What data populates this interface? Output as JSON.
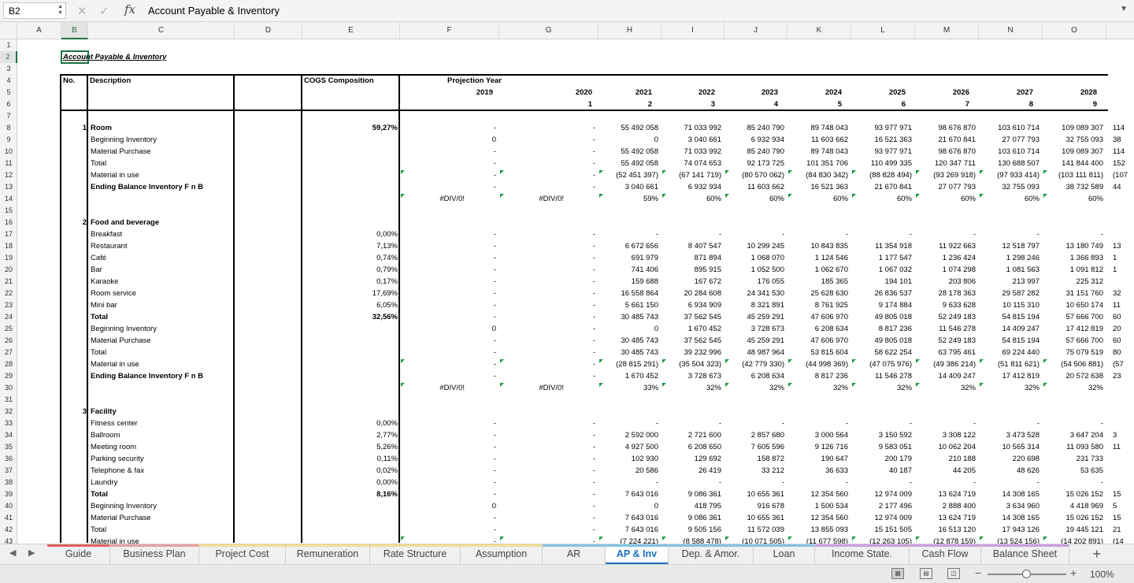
{
  "formula_bar": {
    "name_box": "B2",
    "cancel_icon": "✕",
    "enter_icon": "✓",
    "fx_label": "fx",
    "formula": "Account Payable & Inventory"
  },
  "columns": [
    "A",
    "B",
    "C",
    "D",
    "E",
    "F",
    "G",
    "H",
    "I",
    "J",
    "K",
    "L",
    "M",
    "N",
    "O"
  ],
  "active_column": "B",
  "active_row": 2,
  "rows_visible": [
    1,
    2,
    3,
    4,
    5,
    6,
    7,
    8,
    9,
    10,
    11,
    12,
    13,
    14,
    15,
    16,
    17,
    18,
    19,
    20,
    21,
    22,
    23,
    24,
    25,
    26,
    27,
    28,
    29,
    30,
    31,
    32,
    33,
    34,
    35,
    36,
    37,
    38,
    39,
    40,
    41,
    42,
    43
  ],
  "sheet": {
    "title": "Account Payable & Inventory",
    "header": {
      "no": "No.",
      "description": "Description",
      "cogs": "COGS Composition",
      "projection": "Projection Year",
      "years": [
        "2019",
        "2020",
        "2021",
        "2022",
        "2023",
        "2024",
        "2025",
        "2026",
        "2027",
        "2028"
      ],
      "year_index": [
        "",
        "1",
        "2",
        "3",
        "4",
        "5",
        "6",
        "7",
        "8",
        "9"
      ]
    },
    "rows": [
      {
        "r": 8,
        "no": "1",
        "desc": "Room",
        "bold": true,
        "e": "59,27%",
        "f": "-",
        "g": "-",
        "v": [
          "55 492 058",
          "71 033 992",
          "85 240 790",
          "89 748 043",
          "93 977 971",
          "98 676 870",
          "103 610 714",
          "109 089 307"
        ],
        "p": "114"
      },
      {
        "r": 9,
        "desc": "Beginning Inventory",
        "f": "0",
        "g": "-",
        "v": [
          "0",
          "3 040 661",
          "6 932 934",
          "11 603 662",
          "16 521 363",
          "21 670 841",
          "27 077 793",
          "32 755 093"
        ],
        "p": "38"
      },
      {
        "r": 10,
        "desc": "Material Purchase",
        "f": "-",
        "g": "-",
        "v": [
          "55 492 058",
          "71 033 992",
          "85 240 790",
          "89 748 043",
          "93 977 971",
          "98 676 870",
          "103 610 714",
          "109 089 307"
        ],
        "p": "114"
      },
      {
        "r": 11,
        "desc": "Total",
        "f": "-",
        "g": "-",
        "v": [
          "55 492 058",
          "74 074 653",
          "92 173 725",
          "101 351 706",
          "110 499 335",
          "120 347 711",
          "130 688 507",
          "141 844 400"
        ],
        "p": "152"
      },
      {
        "r": 12,
        "desc": "Material in use",
        "f": "-",
        "g": "-",
        "v": [
          "(52 451 397)",
          "(67 141 719)",
          "(80 570 062)",
          "(84 830 342)",
          "(88 828 494)",
          "(93 269 918)",
          "(97 933 414)",
          "(103 111 811)"
        ],
        "p": "(107"
      },
      {
        "r": 13,
        "desc": "Ending Balance Inventory F n B",
        "bold": true,
        "f": "-",
        "g": "-",
        "v": [
          "3 040 661",
          "6 932 934",
          "11 603 662",
          "16 521 363",
          "21 670 841",
          "27 077 793",
          "32 755 093",
          "38 732 589"
        ],
        "p": "44"
      },
      {
        "r": 14,
        "desc": "",
        "f": "#DIV/0!",
        "g": "#DIV/0!",
        "v": [
          "59%",
          "60%",
          "60%",
          "60%",
          "60%",
          "60%",
          "60%",
          "60%"
        ],
        "p": ""
      },
      {
        "r": 16,
        "no": "2",
        "desc": "Food and beverage",
        "bold": true
      },
      {
        "r": 17,
        "desc": "Breakfast",
        "e": "0,00%",
        "f": "-",
        "g": "-",
        "v": [
          "-",
          "-",
          "-",
          "-",
          "-",
          "-",
          "-",
          "-"
        ],
        "p": ""
      },
      {
        "r": 18,
        "desc": "Restaurant",
        "e": "7,13%",
        "f": "-",
        "g": "-",
        "v": [
          "6 672 656",
          "8 407 547",
          "10 299 245",
          "10 843 835",
          "11 354 918",
          "11 922 663",
          "12 518 797",
          "13 180 749"
        ],
        "p": "13"
      },
      {
        "r": 19,
        "desc": "Café",
        "e": "0,74%",
        "f": "-",
        "g": "-",
        "v": [
          "691 979",
          "871 894",
          "1 068 070",
          "1 124 546",
          "1 177 547",
          "1 236 424",
          "1 298 246",
          "1 366 893"
        ],
        "p": "1"
      },
      {
        "r": 20,
        "desc": "Bar",
        "e": "0,79%",
        "f": "-",
        "g": "-",
        "v": [
          "741 406",
          "895 915",
          "1 052 500",
          "1 062 670",
          "1 067 032",
          "1 074 298",
          "1 081 563",
          "1 091 812"
        ],
        "p": "1"
      },
      {
        "r": 21,
        "desc": "Karaoke",
        "e": "0,17%",
        "f": "-",
        "g": "-",
        "v": [
          "159 688",
          "167 672",
          "176 055",
          "185 365",
          "194 101",
          "203 806",
          "213 997",
          "225 312"
        ],
        "p": ""
      },
      {
        "r": 22,
        "desc": "Room service",
        "e": "17,69%",
        "f": "-",
        "g": "-",
        "v": [
          "16 558 864",
          "20 284 608",
          "24 341 530",
          "25 628 630",
          "26 836 537",
          "28 178 363",
          "29 587 282",
          "31 151 760"
        ],
        "p": "32"
      },
      {
        "r": 23,
        "desc": "Mini bar",
        "e": "6,05%",
        "f": "-",
        "g": "-",
        "v": [
          "5 661 150",
          "6 934 909",
          "8 321 891",
          "8 761 925",
          "9 174 884",
          "9 633 628",
          "10 115 310",
          "10 650 174"
        ],
        "p": "11"
      },
      {
        "r": 24,
        "desc": "Total",
        "bold": true,
        "e": "32,56%",
        "f": "-",
        "g": "-",
        "v": [
          "30 485 743",
          "37 562 545",
          "45 259 291",
          "47 606 970",
          "49 805 018",
          "52 249 183",
          "54 815 194",
          "57 666 700"
        ],
        "p": "60"
      },
      {
        "r": 25,
        "desc": "Beginning Inventory",
        "f": "0",
        "g": "-",
        "v": [
          "0",
          "1 670 452",
          "3 728 673",
          "6 208 634",
          "8 817 236",
          "11 546 278",
          "14 409 247",
          "17 412 819"
        ],
        "p": "20"
      },
      {
        "r": 26,
        "desc": "Material Purchase",
        "f": "-",
        "g": "-",
        "v": [
          "30 485 743",
          "37 562 545",
          "45 259 291",
          "47 606 970",
          "49 805 018",
          "52 249 183",
          "54 815 194",
          "57 666 700"
        ],
        "p": "60"
      },
      {
        "r": 27,
        "desc": "Total",
        "f": "-",
        "g": "-",
        "v": [
          "30 485 743",
          "39 232 996",
          "48 987 964",
          "53 815 604",
          "58 622 254",
          "63 795 461",
          "69 224 440",
          "75 079 519"
        ],
        "p": "80"
      },
      {
        "r": 28,
        "desc": "Material in use",
        "f": "-",
        "g": "-",
        "v": [
          "(28 815 291)",
          "(35 504 323)",
          "(42 779 330)",
          "(44 998 369)",
          "(47 075 976)",
          "(49 386 214)",
          "(51 811 621)",
          "(54 506 881)"
        ],
        "p": "(57"
      },
      {
        "r": 29,
        "desc": "Ending Balance Inventory F n B",
        "bold": true,
        "f": "-",
        "g": "-",
        "v": [
          "1 670 452",
          "3 728 673",
          "6 208 634",
          "8 817 236",
          "11 546 278",
          "14 409 247",
          "17 412 819",
          "20 572 638"
        ],
        "p": "23"
      },
      {
        "r": 30,
        "desc": "",
        "f": "#DIV/0!",
        "g": "#DIV/0!",
        "v": [
          "33%",
          "32%",
          "32%",
          "32%",
          "32%",
          "32%",
          "32%",
          "32%"
        ],
        "p": ""
      },
      {
        "r": 32,
        "no": "3",
        "desc": "Facility",
        "bold": true
      },
      {
        "r": 33,
        "desc": "Fitness center",
        "e": "0,00%",
        "f": "-",
        "g": "-",
        "v": [
          "-",
          "-",
          "-",
          "-",
          "-",
          "-",
          "-",
          "-"
        ],
        "p": ""
      },
      {
        "r": 34,
        "desc": "Ballroom",
        "e": "2,77%",
        "f": "-",
        "g": "-",
        "v": [
          "2 592 000",
          "2 721 600",
          "2 857 680",
          "3 000 564",
          "3 150 592",
          "3 308 122",
          "3 473 528",
          "3 647 204"
        ],
        "p": "3"
      },
      {
        "r": 35,
        "desc": "Meeting room",
        "e": "5,26%",
        "f": "-",
        "g": "-",
        "v": [
          "4 927 500",
          "6 208 650",
          "7 605 596",
          "9 126 716",
          "9 583 051",
          "10 062 204",
          "10 565 314",
          "11 093 580"
        ],
        "p": "11"
      },
      {
        "r": 36,
        "desc": "Parking security",
        "e": "0,11%",
        "f": "-",
        "g": "-",
        "v": [
          "102 930",
          "129 692",
          "158 872",
          "190 647",
          "200 179",
          "210 188",
          "220 698",
          "231 733"
        ],
        "p": ""
      },
      {
        "r": 37,
        "desc": "Telephone & fax",
        "e": "0,02%",
        "f": "-",
        "g": "-",
        "v": [
          "20 586",
          "26 419",
          "33 212",
          "36 633",
          "40 187",
          "44 205",
          "48 626",
          "53 635"
        ],
        "p": ""
      },
      {
        "r": 38,
        "desc": "Laundry",
        "e": "0,00%",
        "f": "-",
        "g": "-",
        "v": [
          "-",
          "-",
          "-",
          "-",
          "-",
          "-",
          "-",
          "-"
        ],
        "p": ""
      },
      {
        "r": 39,
        "desc": "Total",
        "bold": true,
        "e": "8,16%",
        "f": "-",
        "g": "-",
        "v": [
          "7 643 016",
          "9 086 361",
          "10 655 361",
          "12 354 560",
          "12 974 009",
          "13 624 719",
          "14 308 165",
          "15 026 152"
        ],
        "p": "15"
      },
      {
        "r": 40,
        "desc": "Beginning Inventory",
        "f": "0",
        "g": "-",
        "v": [
          "0",
          "418 795",
          "916 678",
          "1 500 534",
          "2 177 496",
          "2 888 400",
          "3 634 960",
          "4 418 969"
        ],
        "p": "5"
      },
      {
        "r": 41,
        "desc": "Material Purchase",
        "f": "-",
        "g": "-",
        "v": [
          "7 643 016",
          "9 086 361",
          "10 655 361",
          "12 354 560",
          "12 974 009",
          "13 624 719",
          "14 308 165",
          "15 026 152"
        ],
        "p": "15"
      },
      {
        "r": 42,
        "desc": "Total",
        "f": "-",
        "g": "-",
        "v": [
          "7 643 016",
          "9 505 156",
          "11 572 039",
          "13 855 093",
          "15 151 505",
          "16 513 120",
          "17 943 126",
          "19 445 121"
        ],
        "p": "21"
      },
      {
        "r": 43,
        "desc": "Material in use",
        "f": "-",
        "g": "-",
        "v": [
          "(7 224 221)",
          "(8 588 478)",
          "(10 071 505)",
          "(11 677 598)",
          "(12 263 105)",
          "(12 878 159)",
          "(13 524 156)",
          "(14 202 891)"
        ],
        "p": "(14"
      }
    ],
    "green_markers": [
      12,
      14,
      28,
      30,
      43
    ]
  },
  "tabs": [
    {
      "label": "Guide",
      "color": "#e06060"
    },
    {
      "label": "Business Plan",
      "color": "#e8a0a0"
    },
    {
      "label": "Project Cost",
      "color": "#f0e08a"
    },
    {
      "label": "Remuneration",
      "color": "#f0e08a"
    },
    {
      "label": "Rate Structure",
      "color": "#f0e08a"
    },
    {
      "label": "Assumption",
      "color": "#f0e08a"
    },
    {
      "label": "AR",
      "color": "#7fc4e6"
    },
    {
      "label": "AP & Inv",
      "color": "#7fc4e6",
      "active": true
    },
    {
      "label": "Dep. & Amor.",
      "color": "#7fc4e6"
    },
    {
      "label": "Loan",
      "color": "#7fc4e6"
    },
    {
      "label": "Income State.",
      "color": "#c9a0dc"
    },
    {
      "label": "Cash Flow",
      "color": "#c9a0dc"
    },
    {
      "label": "Balance Sheet",
      "color": "#c9a0dc"
    }
  ],
  "status": {
    "zoom": "100%",
    "zoom_fraction": 0.5
  }
}
